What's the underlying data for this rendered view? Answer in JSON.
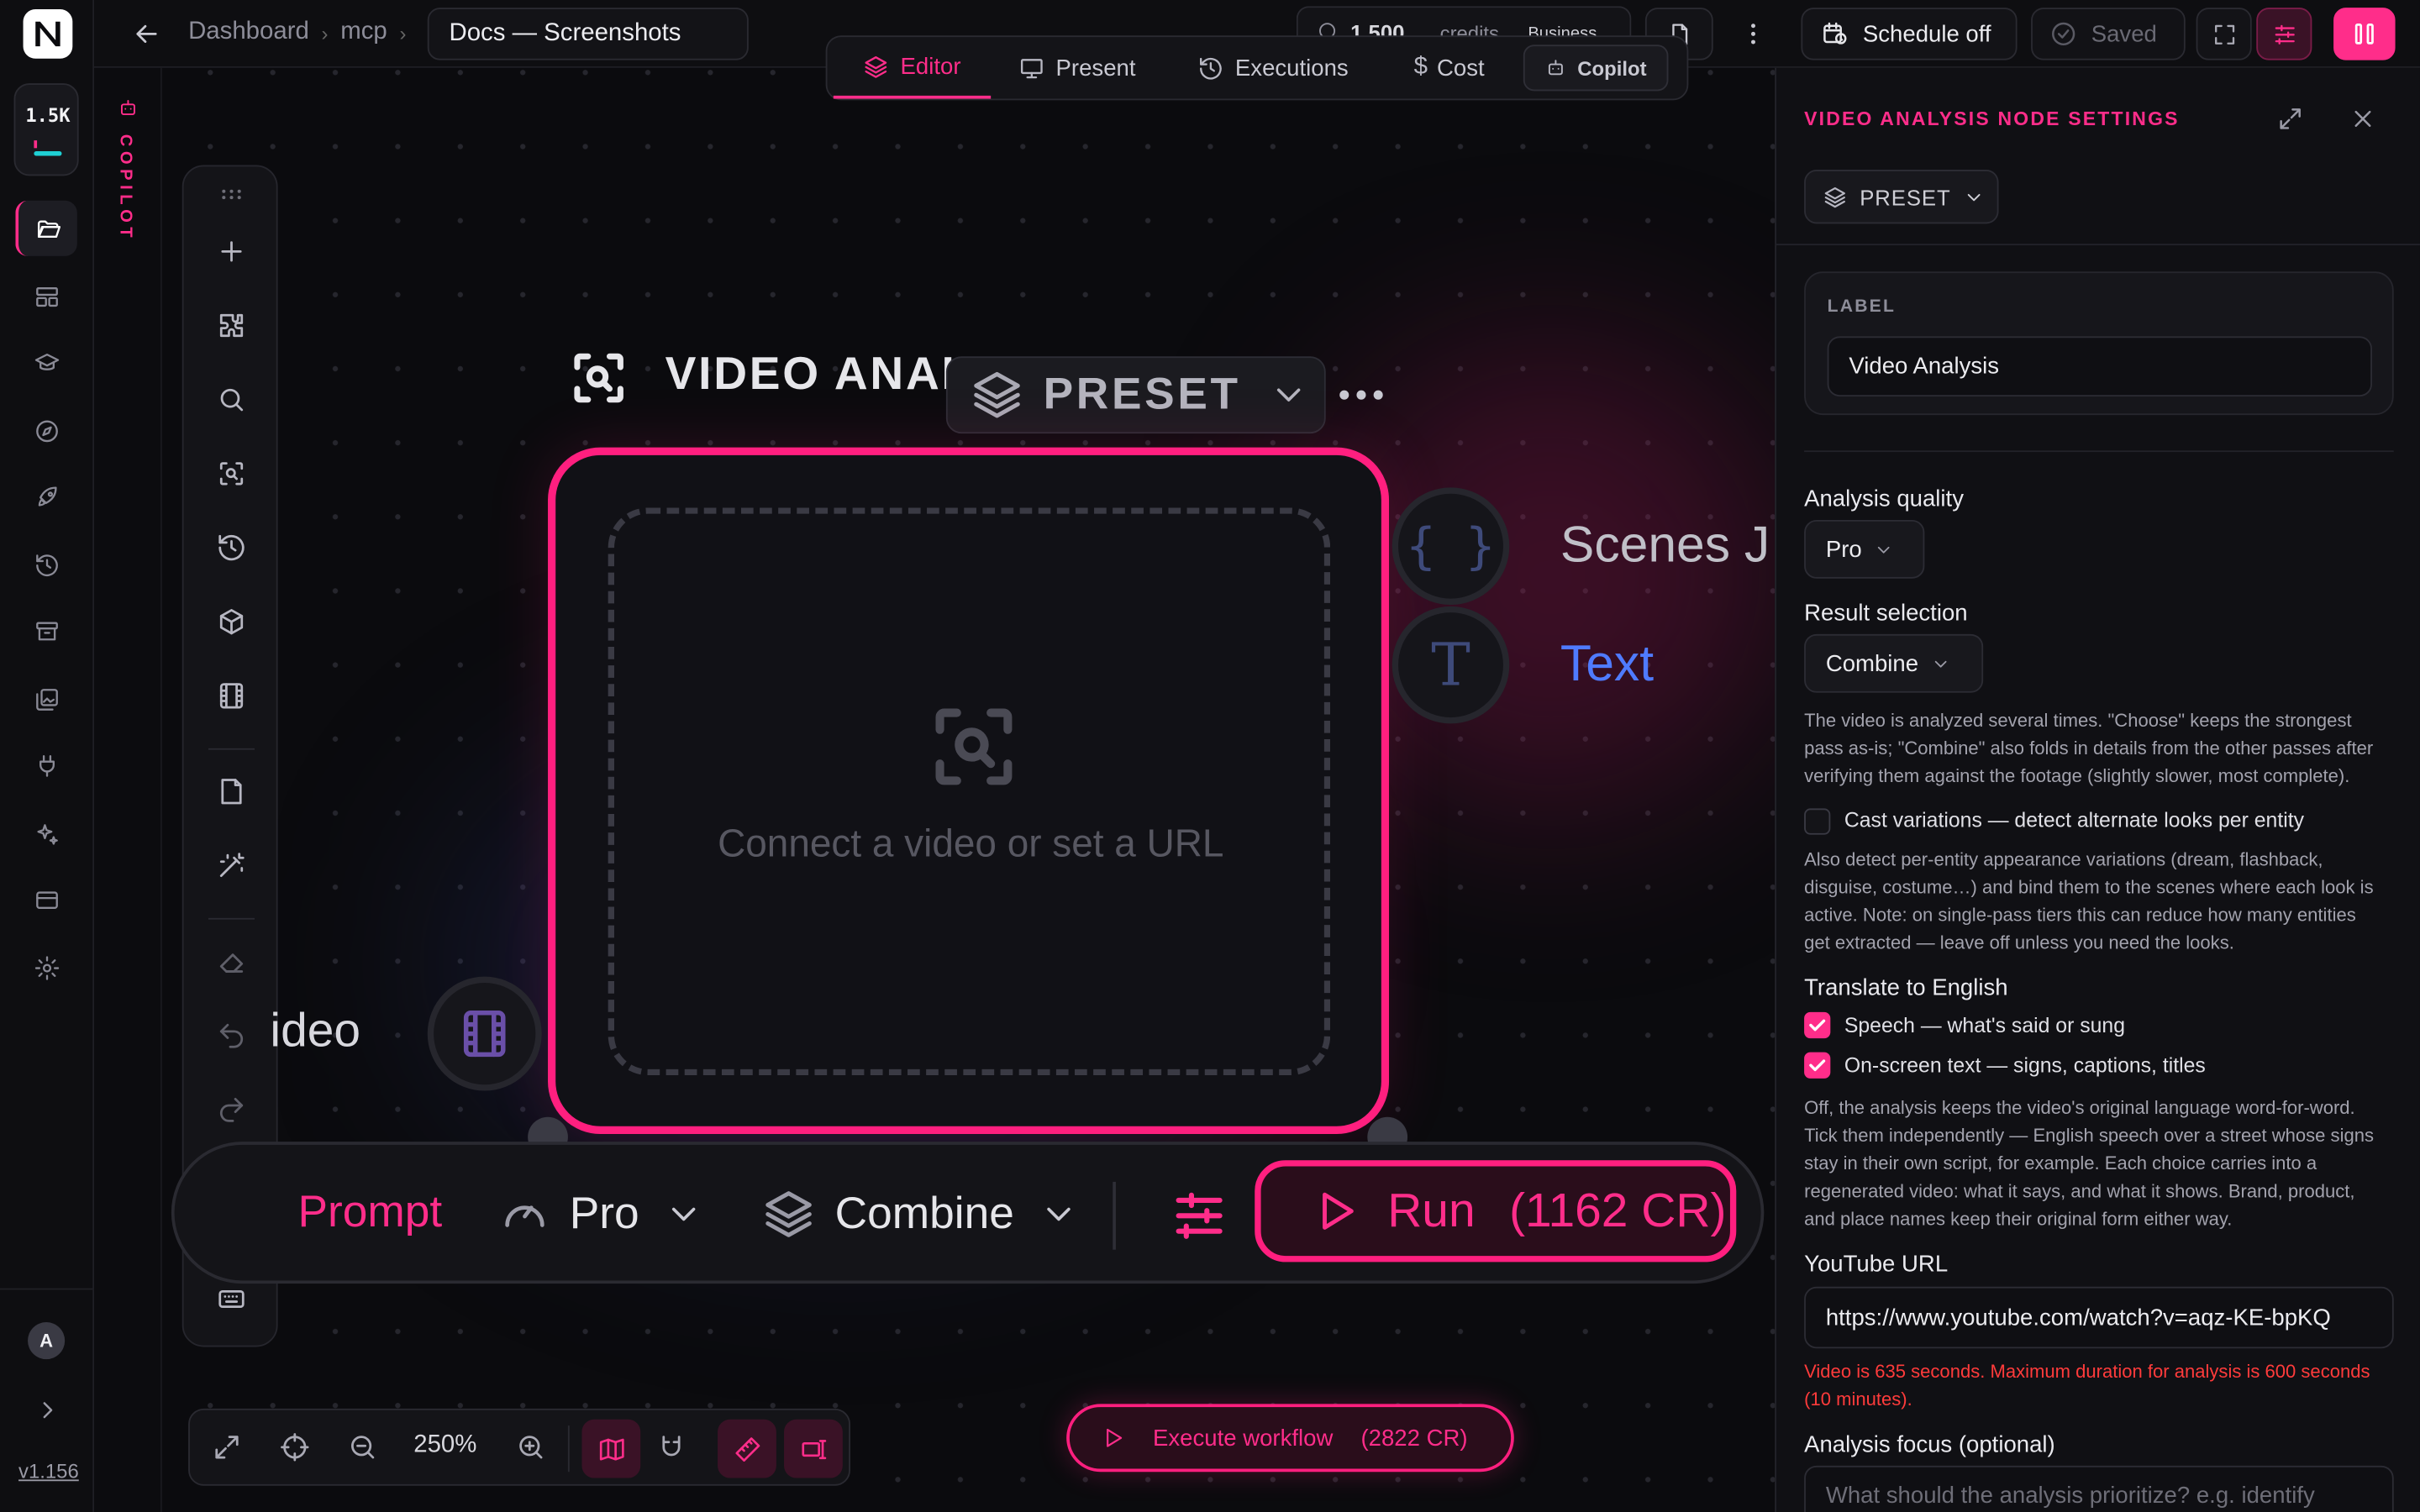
{
  "rail": {
    "credits_badge": "1.5K",
    "avatar_letter": "A",
    "version": "v1.156"
  },
  "copilot_strip": {
    "label": "COPILOT"
  },
  "topbar": {
    "breadcrumb": [
      "Dashboard",
      "mcp"
    ],
    "doc_title": "Docs — Screenshots",
    "credits_value": "1,500",
    "credits_unit": "credits",
    "plan": "Business",
    "schedule_label": "Schedule off",
    "saved_label": "Saved"
  },
  "tabs": [
    {
      "label": "Editor",
      "icon": "layers-icon",
      "active": true
    },
    {
      "label": "Present",
      "icon": "monitor-icon",
      "active": false
    },
    {
      "label": "Executions",
      "icon": "history-icon",
      "active": false
    },
    {
      "label": "Cost",
      "icon": "dollar-icon",
      "active": false
    },
    {
      "label": "Copilot",
      "icon": "robot-icon",
      "active": false
    }
  ],
  "node": {
    "title": "VIDEO ANAL",
    "preset_label": "PRESET",
    "empty_text": "Connect a video or set a URL",
    "input_label": "ideo",
    "outputs": [
      {
        "label": "Scenes J",
        "icon": "braces-icon"
      },
      {
        "label": "Text",
        "icon": "text-icon"
      }
    ],
    "bar": {
      "prompt_label": "Prompt",
      "quality": "Pro",
      "selection": "Combine",
      "run_label": "Run",
      "run_cost": "(1162 CR)"
    }
  },
  "bottom": {
    "zoom": "250%",
    "execute_label": "Execute workflow",
    "execute_cost": "(2822 CR)"
  },
  "panel": {
    "title": "VIDEO ANALYSIS NODE SETTINGS",
    "preset_label": "PRESET",
    "label_caption": "LABEL",
    "label_value": "Video Analysis",
    "quality_label": "Analysis quality",
    "quality_value": "Pro",
    "selection_label": "Result selection",
    "selection_value": "Combine",
    "selection_help": [
      "The video is analyzed several times. \"Choose\" keeps the strongest",
      "pass as-is; \"Combine\" also folds in details from the other passes after",
      "verifying them against the footage (slightly slower, most complete)."
    ],
    "cast_label": "Cast variations — detect alternate looks per entity",
    "cast_checked": false,
    "cast_help": [
      "Also detect per-entity appearance variations (dream, flashback,",
      "disguise, costume…) and bind them to the scenes where each look is",
      "active. Note: on single-pass tiers this can reduce how many entities",
      "get extracted — leave off unless you need the looks."
    ],
    "translate_label": "Translate to English",
    "speech_label": "Speech — what's said or sung",
    "speech_checked": true,
    "onscreen_label": "On-screen text — signs, captions, titles",
    "onscreen_checked": true,
    "translate_help": [
      "Off, the analysis keeps the video's original language word-for-word.",
      "Tick them independently — English speech over a street whose signs",
      "stay in their own script, for example. Each choice carries into a",
      "regenerated video: what it says, and what it shows. Brand, product,",
      "and place names keep their original form either way."
    ],
    "youtube_label": "YouTube URL",
    "youtube_value": "https://www.youtube.com/watch?v=aqz-KE-bpKQ",
    "error_lines": [
      "Video is 635 seconds. Maximum duration for analysis is 600 seconds",
      "(10 minutes)."
    ],
    "focus_label": "Analysis focus (optional)",
    "focus_placeholder": "What should the analysis prioritize? e.g. identify"
  },
  "colors": {
    "accent": "#ff2d8a",
    "link": "#4f7bff",
    "error": "#ff3b3b"
  }
}
